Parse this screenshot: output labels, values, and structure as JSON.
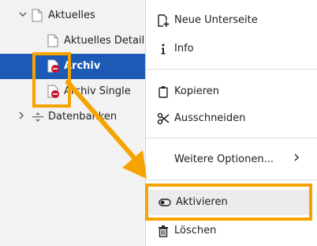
{
  "tree": {
    "items": [
      {
        "label": "Aktuelles",
        "icon": "page-icon",
        "expander": "chevron-down-icon"
      },
      {
        "label": "Aktuelles Detail",
        "icon": "page-icon"
      },
      {
        "label": "Archiv",
        "icon": "page-disabled-icon",
        "selected": true
      },
      {
        "label": "Archiv Single",
        "icon": "page-disabled-icon"
      },
      {
        "label": "Datenbanken",
        "icon": "separator-icon",
        "expander": "chevron-right-icon"
      }
    ]
  },
  "context_menu": {
    "items": [
      {
        "label": "Neue Unterseite",
        "icon": "new-page-icon"
      },
      {
        "label": "Info",
        "icon": "info-icon"
      },
      {
        "label": "Kopieren",
        "icon": "copy-icon"
      },
      {
        "label": "Ausschneiden",
        "icon": "scissors-icon"
      },
      {
        "label": "Weitere Optionen...",
        "icon": "chevron-right-icon"
      },
      {
        "label": "Aktivieren",
        "icon": "toggle-icon",
        "highlighted": true
      },
      {
        "label": "Löschen",
        "icon": "trash-icon"
      }
    ]
  },
  "colors": {
    "selection": "#1c5ab5",
    "annotation": "#f5a300",
    "disabled_badge": "#c8102e"
  }
}
